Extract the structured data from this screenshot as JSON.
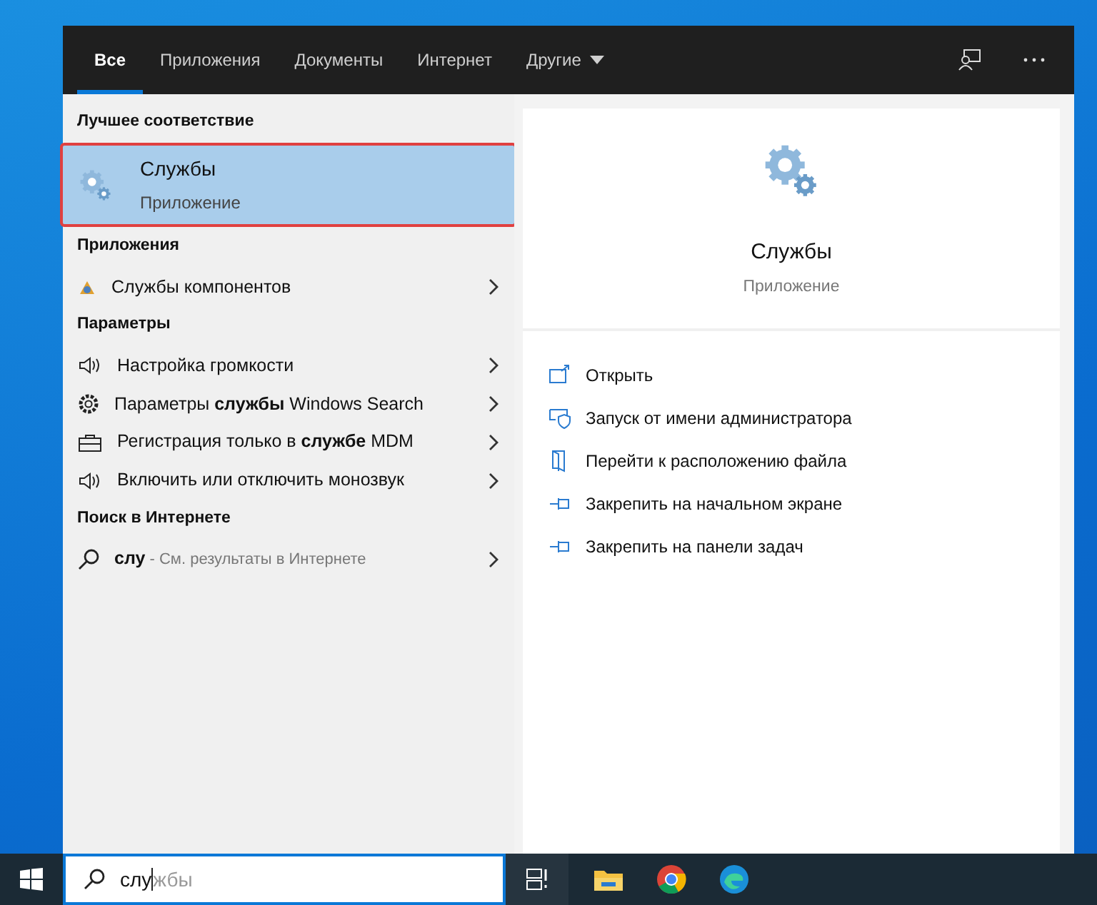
{
  "tabs": [
    {
      "label": "Все",
      "selected": true
    },
    {
      "label": "Приложения",
      "selected": false
    },
    {
      "label": "Документы",
      "selected": false
    },
    {
      "label": "Интернет",
      "selected": false
    },
    {
      "label": "Другие",
      "selected": false,
      "dropdown": true
    }
  ],
  "sections": [
    {
      "heading": "Лучшее соответствие",
      "items": [
        {
          "kind": "best",
          "title": "Службы",
          "subtitle": "Приложение",
          "selected": true
        }
      ]
    },
    {
      "heading": "Приложения",
      "items": [
        {
          "kind": "app",
          "title": "Службы компонентов"
        }
      ]
    },
    {
      "heading": "Параметры",
      "items": [
        {
          "kind": "volume",
          "title": "Настройка громкости"
        },
        {
          "kind": "gear",
          "title": "Параметры **службы** Windows Search"
        },
        {
          "kind": "briefcase",
          "title": "Регистрация только в **службе** MDM"
        },
        {
          "kind": "volume",
          "title": "Включить или отключить монозвук"
        }
      ]
    },
    {
      "heading": "Поиск в Интернете",
      "items": [
        {
          "kind": "web",
          "title": "слу",
          "hint": " - См. результаты в Интернете"
        }
      ]
    }
  ],
  "preview": {
    "title": "Службы",
    "subtitle": "Приложение"
  },
  "actions": [
    {
      "kind": "open",
      "label": "Открыть"
    },
    {
      "kind": "admin",
      "label": "Запуск от имени администратора"
    },
    {
      "kind": "file",
      "label": "Перейти к расположению файла"
    },
    {
      "kind": "pin",
      "label": "Закрепить на начальном экране"
    },
    {
      "kind": "pin",
      "label": "Закрепить на панели задач"
    }
  ],
  "search": {
    "value": "слу",
    "suggestion": "жбы"
  }
}
